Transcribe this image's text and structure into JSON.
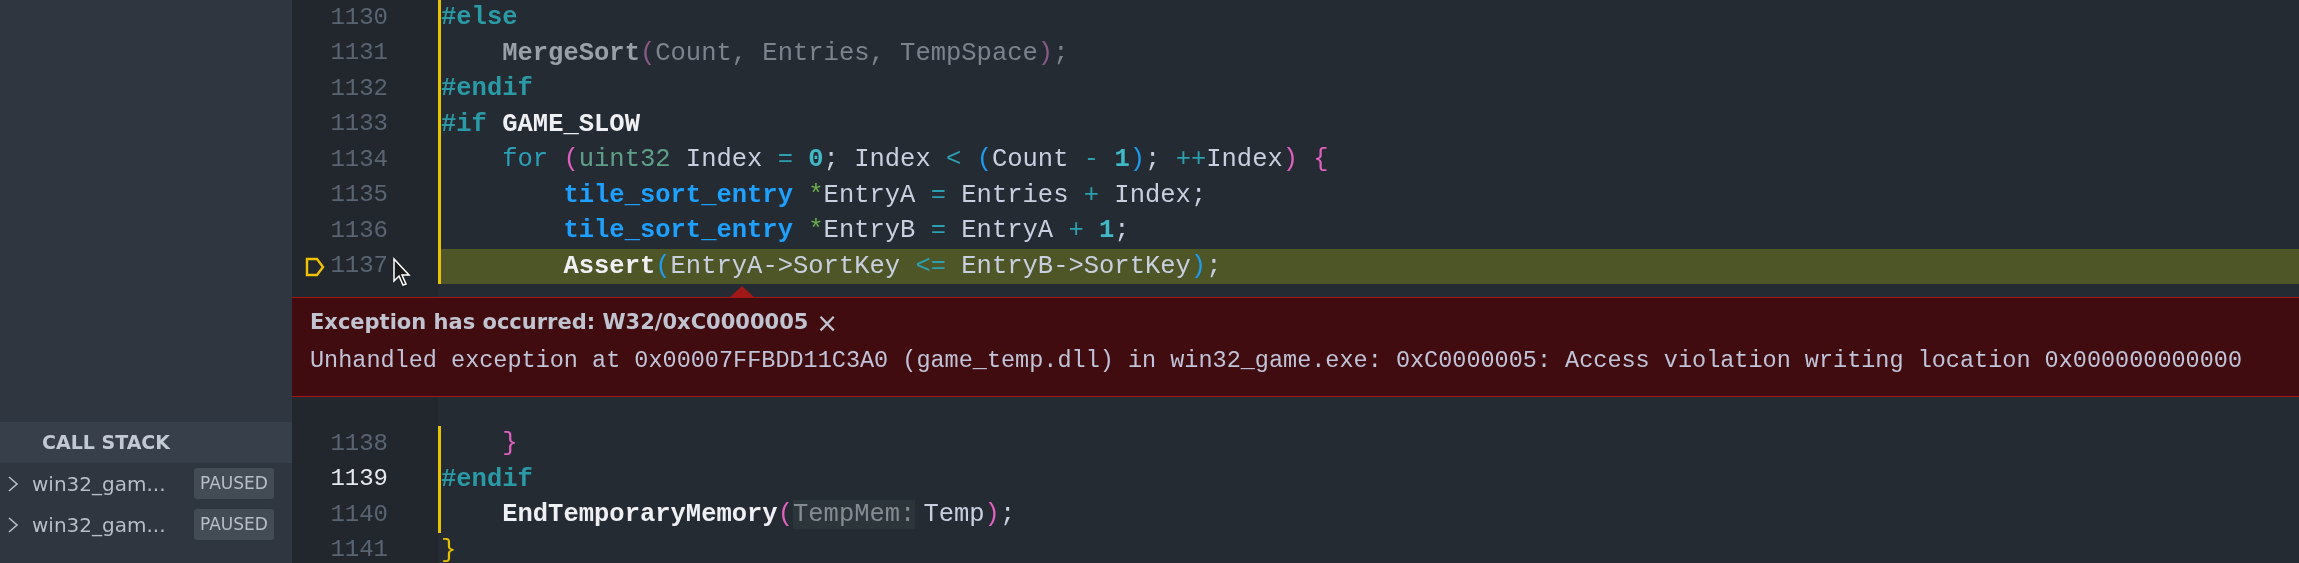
{
  "sidebar": {
    "call_stack": {
      "title": "CALL STACK",
      "threads": [
        {
          "name": "win32_gam...",
          "status": "PAUSED",
          "expanded": false
        },
        {
          "name": "win32_gam...",
          "status": "PAUSED",
          "expanded": false
        }
      ]
    }
  },
  "editor": {
    "lines": [
      {
        "number": "1130",
        "modified": true,
        "current": false,
        "exception": false,
        "tokens": [
          {
            "text": "#else",
            "kind": "dir"
          }
        ]
      },
      {
        "number": "1131",
        "modified": true,
        "current": false,
        "exception": false,
        "tokens": [
          {
            "text": "    MergeSort",
            "kind": "dimfn"
          },
          {
            "text": "(",
            "kind": "dimparen"
          },
          {
            "text": "Count, Entries, TempSpace",
            "kind": "dim"
          },
          {
            "text": ")",
            "kind": "dimparen"
          },
          {
            "text": ";",
            "kind": "dim"
          }
        ]
      },
      {
        "number": "1132",
        "modified": true,
        "current": false,
        "exception": false,
        "tokens": [
          {
            "text": "#endif",
            "kind": "dir"
          }
        ]
      },
      {
        "number": "1133",
        "modified": true,
        "current": false,
        "exception": false,
        "tokens": [
          {
            "text": "#if",
            "kind": "dir"
          },
          {
            "text": " GAME_SLOW",
            "kind": "macro"
          }
        ]
      },
      {
        "number": "1134",
        "modified": true,
        "current": false,
        "exception": false,
        "tokens": [
          {
            "text": "    for ",
            "kind": "kw"
          },
          {
            "text": "(",
            "kind": "paren"
          },
          {
            "text": "uint32",
            "kind": "type"
          },
          {
            "text": " Index ",
            "kind": "plain"
          },
          {
            "text": "= ",
            "kind": "op"
          },
          {
            "text": "0",
            "kind": "num"
          },
          {
            "text": "; Index ",
            "kind": "plain"
          },
          {
            "text": "< ",
            "kind": "op"
          },
          {
            "text": "(",
            "kind": "paren2"
          },
          {
            "text": "Count ",
            "kind": "plain"
          },
          {
            "text": "- ",
            "kind": "op"
          },
          {
            "text": "1",
            "kind": "num"
          },
          {
            "text": ")",
            "kind": "paren2"
          },
          {
            "text": "; ",
            "kind": "plain"
          },
          {
            "text": "++",
            "kind": "op"
          },
          {
            "text": "Index",
            "kind": "plain"
          },
          {
            "text": ") {",
            "kind": "paren"
          }
        ]
      },
      {
        "number": "1135",
        "modified": true,
        "current": false,
        "exception": false,
        "tokens": [
          {
            "text": "        tile_sort_entry ",
            "kind": "utype"
          },
          {
            "text": "*",
            "kind": "ptr"
          },
          {
            "text": "EntryA ",
            "kind": "plain"
          },
          {
            "text": "=",
            "kind": "op"
          },
          {
            "text": " Entries ",
            "kind": "plain"
          },
          {
            "text": "+",
            "kind": "op"
          },
          {
            "text": " Index;",
            "kind": "plain"
          }
        ]
      },
      {
        "number": "1136",
        "modified": true,
        "current": false,
        "exception": false,
        "tokens": [
          {
            "text": "        tile_sort_entry ",
            "kind": "utype"
          },
          {
            "text": "*",
            "kind": "ptr"
          },
          {
            "text": "EntryB ",
            "kind": "plain"
          },
          {
            "text": "=",
            "kind": "op"
          },
          {
            "text": " EntryA ",
            "kind": "plain"
          },
          {
            "text": "+ ",
            "kind": "op"
          },
          {
            "text": "1",
            "kind": "num"
          },
          {
            "text": ";",
            "kind": "plain"
          }
        ]
      },
      {
        "number": "1137",
        "modified": true,
        "current": false,
        "exception": true,
        "tokens": [
          {
            "text": "        Assert",
            "kind": "fn"
          },
          {
            "text": "(",
            "kind": "paren2"
          },
          {
            "text": "EntryA->SortKey ",
            "kind": "plain"
          },
          {
            "text": "<=",
            "kind": "op"
          },
          {
            "text": " EntryB->SortKey",
            "kind": "plain"
          },
          {
            "text": ")",
            "kind": "paren2"
          },
          {
            "text": ";",
            "kind": "plain"
          }
        ]
      },
      {
        "number": "1138",
        "modified": true,
        "current": false,
        "exception": false,
        "tokens": [
          {
            "text": "    }",
            "kind": "paren"
          }
        ]
      },
      {
        "number": "1139",
        "modified": true,
        "current": true,
        "exception": false,
        "tokens": [
          {
            "text": "#endif",
            "kind": "dir"
          }
        ]
      },
      {
        "number": "1140",
        "modified": true,
        "current": false,
        "exception": false,
        "tokens": [
          {
            "text": "    EndTemporaryMemory",
            "kind": "fn"
          },
          {
            "text": "(",
            "kind": "paren"
          },
          {
            "text": "TempMem:",
            "kind": "inlay"
          },
          {
            "text": "Temp",
            "kind": "plain"
          },
          {
            "text": ")",
            "kind": "paren"
          },
          {
            "text": ";",
            "kind": "plain"
          }
        ]
      },
      {
        "number": "1141",
        "modified": false,
        "current": false,
        "exception": false,
        "tokens": [
          {
            "text": "}",
            "kind": "gold"
          }
        ]
      }
    ],
    "exception": {
      "title": "Exception has occurred: W32/0xC0000005",
      "close": "×",
      "message": "Unhandled exception at 0x00007FFBDD11C3A0 (game_temp.dll) in win32_game.exe: 0xC0000005: Access violation writing location 0x000000000000"
    }
  }
}
